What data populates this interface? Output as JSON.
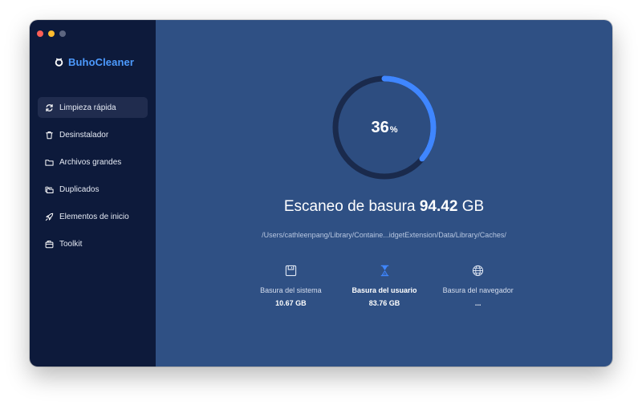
{
  "app": {
    "name": "BuhoCleaner"
  },
  "sidebar": {
    "items": [
      {
        "label": "Limpieza rápida",
        "active": true
      },
      {
        "label": "Desinstalador"
      },
      {
        "label": "Archivos grandes"
      },
      {
        "label": "Duplicados"
      },
      {
        "label": "Elementos de inicio"
      },
      {
        "label": "Toolkit"
      }
    ]
  },
  "scan": {
    "progress_value": "36",
    "progress_unit": "%",
    "progress_fraction": 0.36,
    "title": "Escaneo de basura",
    "total_amount": "94.42",
    "total_unit": "GB",
    "current_path": "/Users/cathleenpang/Library/Containe...idgetExtension/Data/Library/Caches/"
  },
  "categories": [
    {
      "label": "Basura del sistema",
      "value": "10.67",
      "unit": "GB",
      "icon": "disk-icon"
    },
    {
      "label": "Basura del usuario",
      "value": "83.76",
      "unit": "GB",
      "icon": "hourglass-icon",
      "active": true
    },
    {
      "label": "Basura del navegador",
      "value": "...",
      "unit": "",
      "icon": "globe-icon"
    }
  ],
  "colors": {
    "sidebar_bg": "#0d1a3b",
    "main_bg": "#2f5084",
    "accent": "#3f86ff",
    "brand": "#4d9bff"
  }
}
